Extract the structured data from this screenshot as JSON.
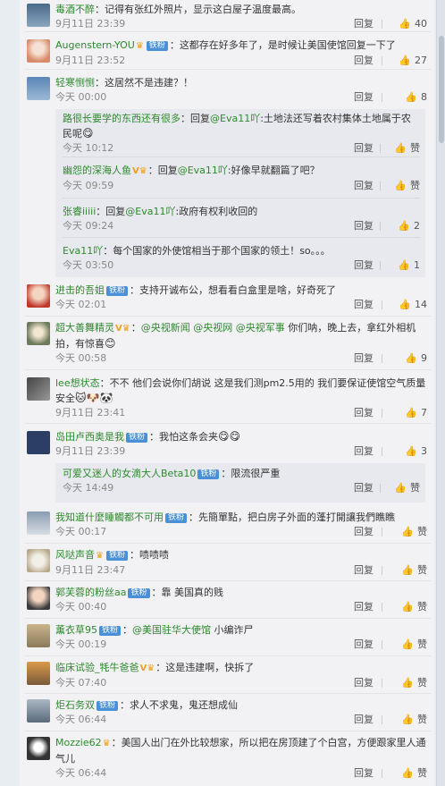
{
  "comments": [
    {
      "user": "毒酒不醉",
      "text": "记得有张红外照片，显示这白屋子温度最高。",
      "time": "9月11日 23:39",
      "reply": "回复",
      "likes": "40"
    },
    {
      "user": "Augenstern-YOU",
      "text": "这都存在好多年了，是时候让美国使馆回复一下了",
      "time": "9月11日 23:52",
      "reply": "回复",
      "likes": "27"
    },
    {
      "user": "轻寒恻恻",
      "text": "这居然不是违建？！",
      "time": "今天 00:00",
      "reply": "回复",
      "likes": "8"
    },
    {
      "user": "进击的吾姐",
      "badge": "铁粉",
      "text": "支持开诚布公，想看看白盒里是啥，好奇死了",
      "time": "今天 02:01",
      "reply": "回复",
      "likes": "14"
    },
    {
      "user": "超大善舞精灵",
      "mentions": [
        "@央视新闻",
        "@央视网",
        "@央视军事"
      ],
      "text": "你们呐，晚上去，拿红外相机拍，有惊喜",
      "time": "今天 00:58",
      "reply": "回复",
      "likes": "9"
    },
    {
      "user": "lee想状态",
      "text": "不不 他们会说你们胡说 这是我们测pm2.5用的 我们要保证使馆空气质量安全",
      "time": "9月11日 23:41",
      "reply": "回复",
      "likes": "7"
    },
    {
      "user": "岛田卢西奥是我",
      "badge": "铁粉",
      "text": "我怕这条会夹",
      "time": "9月11日 23:39",
      "reply": "回复",
      "likes": "3"
    },
    {
      "user": "我知道什麼睡觸都不可用",
      "badge": "铁粉",
      "text": "先簡單點，把白房子外面的蓬打開讓我們瞧瞧",
      "time": "今天 00:17",
      "reply": "回复",
      "likes": "赞"
    },
    {
      "user": "风哒声音",
      "text": "啧啧啧",
      "time": "9月11日 23:47",
      "reply": "回复",
      "likes": "赞"
    },
    {
      "user": "郭芙蓉的粉丝aa",
      "badge": "铁粉",
      "text": "靠 美国真的贱",
      "time": "今天 00:40",
      "reply": "回复",
      "likes": "赞"
    },
    {
      "user": "薰衣草95",
      "badge": "铁粉",
      "mention": "@美国驻华大使馆",
      "text": "小编诈尸",
      "time": "今天 00:19",
      "reply": "回复",
      "likes": "赞"
    },
    {
      "user": "临床试验_牦牛爸爸",
      "text": "这是违建啊，快拆了",
      "time": "今天 07:40",
      "reply": "回复",
      "likes": "赞"
    },
    {
      "user": "炬石务双",
      "badge": "铁粉",
      "text": "求人不求鬼，鬼还想成仙",
      "time": "今天 06:44",
      "reply": "回复",
      "likes": "赞"
    },
    {
      "user": "Mozzie62",
      "text": "美国人出门在外比较想家，所以把在房顶建了个白宫，方便跟家里人通气儿",
      "time": "今天 06:44",
      "reply": "回复",
      "likes": "赞"
    }
  ],
  "subreplies_a": [
    {
      "user": "路很长要学的东西还有很多",
      "prefix": "回复",
      "mention": "@Eva11吖",
      "text": ":土地法还写着农村集体土地属于农民呢",
      "time": "今天 10:12",
      "reply": "回复",
      "likes": "赞"
    },
    {
      "user": "幽怨的深海人鱼",
      "prefix": "回复",
      "mention": "@Eva11吖",
      "text": ":好像早就翻篇了吧？",
      "time": "今天 09:59",
      "reply": "回复",
      "likes": "赞"
    },
    {
      "user": "张睿iiiii",
      "prefix": "回复",
      "mention": "@Eva11吖",
      "text": ":政府有权利收回的",
      "time": "今天 09:24",
      "reply": "回复",
      "likes": "2"
    },
    {
      "user": "Eva11吖",
      "text": "每个国家的外使馆相当于那个国家的领土！so。。。",
      "time": "今天 03:50",
      "reply": "回复",
      "likes": "1"
    }
  ],
  "subreplies_b": [
    {
      "user": "可爱又迷人的女滴大人Beta10",
      "badge": "铁粉",
      "text": "限流很严重",
      "time": "今天 14:49",
      "reply": "回复",
      "likes": "赞"
    }
  ],
  "colors": {
    "name": "#2d8a2d",
    "badge": "#4a90d9",
    "vip": "#f0a01a"
  }
}
